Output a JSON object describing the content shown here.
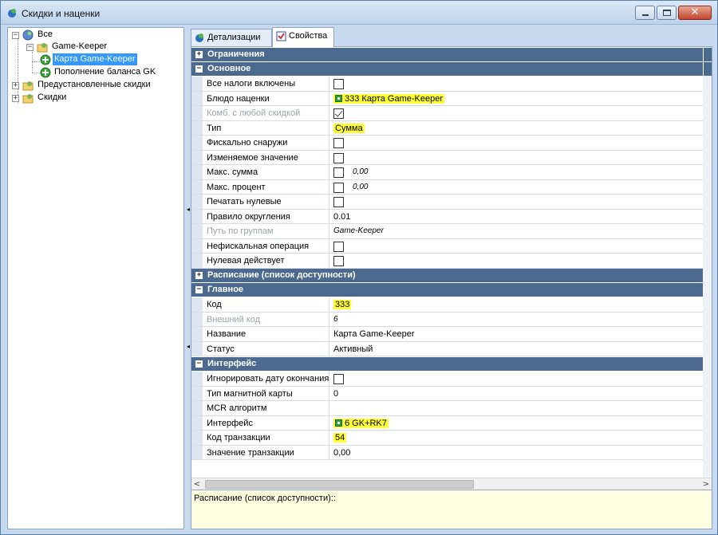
{
  "window": {
    "title": "Скидки и наценки",
    "close_glyph": "✕"
  },
  "tree": {
    "root": "Все",
    "game_keeper": "Game-Keeper",
    "card": "Карта Game-Keeper",
    "balance": "Пополнение баланса GK",
    "preset": "Предустановленные скидки",
    "discounts": "Скидки"
  },
  "tabs": {
    "details": "Детализации",
    "properties": "Свойства"
  },
  "categories": {
    "limits": "Ограничения",
    "basic": "Основное",
    "schedule": "Расписание (список доступности)",
    "main": "Главное",
    "interface": "Интерфейс"
  },
  "basic": {
    "r1": {
      "name": "Все налоги включены"
    },
    "r2": {
      "name": "Блюдо наценки",
      "value": "333 Карта Game-Keeper"
    },
    "r3": {
      "name": "Комб. с любой скидкой"
    },
    "r4": {
      "name": "Тип",
      "value": "Сумма"
    },
    "r5": {
      "name": "Фискально снаружи"
    },
    "r6": {
      "name": "Изменяемое значение"
    },
    "r7": {
      "name": "Макс. сумма",
      "value": "0,00"
    },
    "r8": {
      "name": "Макс. процент",
      "value": "0,00"
    },
    "r9": {
      "name": "Печатать нулевые"
    },
    "r10": {
      "name": "Правило округления",
      "value": "0.01"
    },
    "r11": {
      "name": "Путь по группам",
      "value": "Game-Keeper"
    },
    "r12": {
      "name": "Нефискальная операция"
    },
    "r13": {
      "name": "Нулевая действует"
    }
  },
  "main_section": {
    "r1": {
      "name": "Код",
      "value": "333"
    },
    "r2": {
      "name": "Внешний код",
      "value": "6"
    },
    "r3": {
      "name": "Название",
      "value": "Карта Game-Keeper"
    },
    "r4": {
      "name": "Статус",
      "value": "Активный"
    }
  },
  "interface_section": {
    "r1": {
      "name": "Игнорировать дату окончания"
    },
    "r2": {
      "name": "Тип магнитной карты",
      "value": "0"
    },
    "r3": {
      "name": "MCR алгоритм",
      "value": ""
    },
    "r4": {
      "name": "Интерфейс",
      "value": "6 GK+RK7"
    },
    "r5": {
      "name": "Код транзакции",
      "value": "54"
    },
    "r6": {
      "name": "Значение транзакции",
      "value": "0,00"
    }
  },
  "scroll": {
    "left_arrow": "<",
    "right_arrow": ">"
  },
  "description": "Расписание (список доступности)::",
  "colors": {
    "category_header": "#4c6a8f",
    "highlight": "#ffff33",
    "selection": "#3399ff"
  }
}
